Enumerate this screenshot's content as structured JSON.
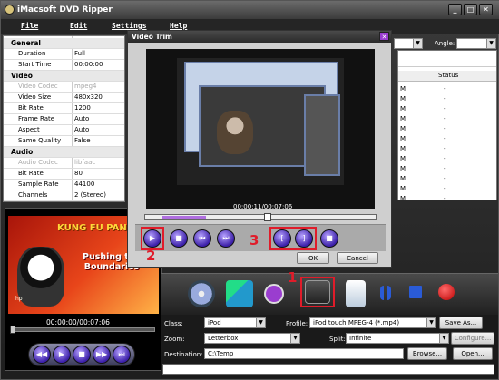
{
  "app": {
    "title": "iMacsoft DVD Ripper",
    "colors": {
      "accent": "#3b1fa8",
      "highlight": "#e01c2a",
      "dialog_close": "#9a3dcf"
    }
  },
  "menu": [
    "File",
    "Edit",
    "Settings",
    "Help"
  ],
  "window_buttons": [
    "_",
    "□",
    "✕"
  ],
  "props": {
    "sections": [
      {
        "title": "General",
        "rows": [
          [
            "Duration",
            "Full"
          ],
          [
            "Start Time",
            "00:00:00"
          ]
        ]
      },
      {
        "title": "Video",
        "rows": [
          [
            "Video Codec",
            "mpeg4"
          ],
          [
            "Video Size",
            "480x320"
          ],
          [
            "Bit Rate",
            "1200"
          ],
          [
            "Frame Rate",
            "Auto"
          ],
          [
            "Aspect",
            "Auto"
          ],
          [
            "Same Quality",
            "False"
          ]
        ]
      },
      {
        "title": "Audio",
        "rows": [
          [
            "Audio Codec",
            "libfaac"
          ],
          [
            "Bit Rate",
            "80"
          ],
          [
            "Sample Rate",
            "44100"
          ],
          [
            "Channels",
            "2 (Stereo)"
          ]
        ]
      }
    ]
  },
  "right_list": {
    "angle_label": "Angle:",
    "status_header": "Status",
    "rows": [
      [
        "M",
        "-"
      ],
      [
        "M",
        "-"
      ],
      [
        "M",
        "-"
      ],
      [
        "M",
        "-"
      ],
      [
        "M",
        "-"
      ],
      [
        "M",
        "-"
      ],
      [
        "M",
        "-"
      ],
      [
        "M",
        "-"
      ],
      [
        "M",
        "-"
      ],
      [
        "M",
        "-"
      ],
      [
        "M",
        "-"
      ],
      [
        "M",
        "-"
      ]
    ]
  },
  "preview": {
    "poster_brand": "KUNG FU PANDA",
    "poster_tagline": "Pushing the Boundaries",
    "poster_logo": "hp",
    "time": "00:00:00/00:07:06",
    "controls": [
      "◀◀",
      "▶",
      "■",
      "▶▶",
      "⏭"
    ]
  },
  "dialog": {
    "title": "Video Trim",
    "close": "✕",
    "time": "00:00:11/00:07:06",
    "trim_fraction": 0.03,
    "buttons_left": [
      "▶",
      "■",
      "⏮",
      "⏭"
    ],
    "buttons_mark": [
      "[",
      "]",
      "■"
    ],
    "ok": "OK",
    "cancel": "Cancel"
  },
  "annotations": {
    "n1": "1",
    "n2": "2",
    "n3": "3"
  },
  "settings": {
    "class_label": "Class:",
    "class_value": "iPod",
    "profile_label": "Profile:",
    "profile_value": "iPod touch MPEG-4  (*.mp4)",
    "save_as": "Save As...",
    "zoom_label": "Zoom:",
    "zoom_value": "Letterbox",
    "split_label": "Split:",
    "split_value": "Infinite",
    "configure": "Configure...",
    "dest_label": "Destination:",
    "dest_value": "C:\\Temp",
    "browse": "Browse...",
    "open": "Open..."
  },
  "toolbar_icons": [
    "dvd-load-icon",
    "import-icon",
    "effect-icon",
    "trim-icon",
    "document-icon",
    "pause-icon",
    "stop-icon",
    "record-icon"
  ]
}
